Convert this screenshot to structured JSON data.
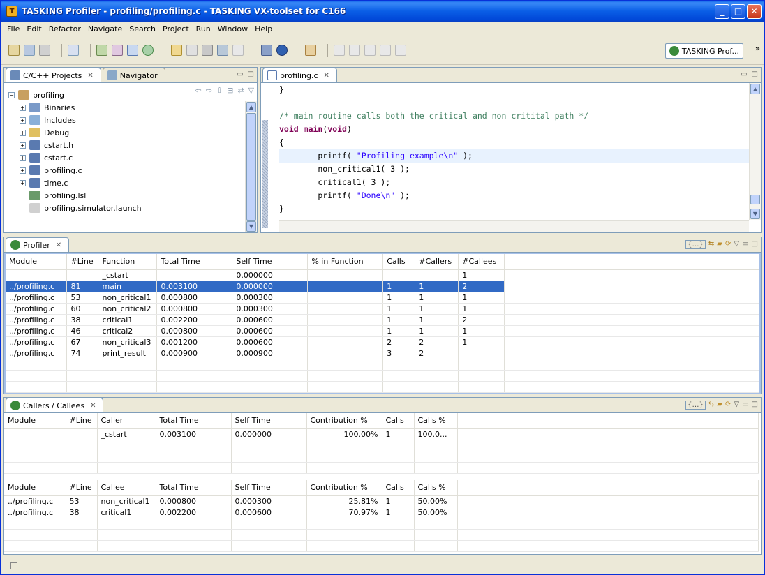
{
  "window": {
    "title": "TASKING Profiler - profiling/profiling.c - TASKING VX-toolset for C166",
    "minimize": "_",
    "maximize": "□",
    "close": "✕"
  },
  "menu": [
    "File",
    "Edit",
    "Refactor",
    "Navigate",
    "Search",
    "Project",
    "Run",
    "Window",
    "Help"
  ],
  "perspective": {
    "label": "TASKING Prof...",
    "more": "»"
  },
  "left_pane": {
    "tabs": [
      {
        "label": "C/C++ Projects"
      },
      {
        "label": "Navigator"
      }
    ],
    "close": "✕",
    "tree": [
      {
        "label": "profiling",
        "depth": 0,
        "toggle": "−"
      },
      {
        "label": "Binaries",
        "depth": 1,
        "toggle": "+"
      },
      {
        "label": "Includes",
        "depth": 1,
        "toggle": "+"
      },
      {
        "label": "Debug",
        "depth": 1,
        "toggle": "+"
      },
      {
        "label": "cstart.h",
        "depth": 1,
        "toggle": "+"
      },
      {
        "label": "cstart.c",
        "depth": 1,
        "toggle": "+"
      },
      {
        "label": "profiling.c",
        "depth": 1,
        "toggle": "+"
      },
      {
        "label": "time.c",
        "depth": 1,
        "toggle": "+"
      },
      {
        "label": "profiling.lsl",
        "depth": 1,
        "toggle": ""
      },
      {
        "label": "profiling.simulator.launch",
        "depth": 1,
        "toggle": ""
      }
    ]
  },
  "editor": {
    "tab": "profiling.c",
    "close": "✕",
    "lines": [
      {
        "parts": [
          {
            "t": "}",
            "c": ""
          }
        ]
      },
      {
        "parts": [
          {
            "t": "",
            "c": ""
          }
        ]
      },
      {
        "parts": [
          {
            "t": "/* main routine calls both the critical and non critital path */",
            "c": "cm"
          }
        ]
      },
      {
        "parts": [
          {
            "t": "void",
            "c": "kw"
          },
          {
            "t": " ",
            "c": ""
          },
          {
            "t": "main",
            "c": "kw"
          },
          {
            "t": "(",
            "c": ""
          },
          {
            "t": "void",
            "c": "kw"
          },
          {
            "t": ")",
            "c": ""
          }
        ]
      },
      {
        "parts": [
          {
            "t": "{",
            "c": ""
          }
        ]
      },
      {
        "parts": [
          {
            "t": "        printf( ",
            "c": ""
          },
          {
            "t": "\"Profiling example\\n\"",
            "c": "str"
          },
          {
            "t": " );",
            "c": ""
          }
        ],
        "highlight": true
      },
      {
        "parts": [
          {
            "t": "        non_critical1( 3 );",
            "c": ""
          }
        ]
      },
      {
        "parts": [
          {
            "t": "        critical1( 3 );",
            "c": ""
          }
        ]
      },
      {
        "parts": [
          {
            "t": "        printf( ",
            "c": ""
          },
          {
            "t": "\"Done\\n\"",
            "c": "str"
          },
          {
            "t": " );",
            "c": ""
          }
        ]
      },
      {
        "parts": [
          {
            "t": "}",
            "c": ""
          }
        ]
      }
    ]
  },
  "profiler": {
    "tab": "Profiler",
    "close": "✕",
    "columns": [
      "Module",
      "#Line",
      "Function",
      "Total Time",
      "Self Time",
      "% in Function",
      "Calls",
      "#Callers",
      "#Callees"
    ],
    "rows": [
      [
        "",
        "",
        "_cstart",
        "",
        "0.000000",
        "",
        "",
        "",
        "1"
      ],
      [
        "../profiling.c",
        "81",
        "main",
        "0.003100",
        "0.000000",
        "",
        "1",
        "1",
        "2"
      ],
      [
        "../profiling.c",
        "53",
        "non_critical1",
        "0.000800",
        "0.000300",
        "",
        "1",
        "1",
        "1"
      ],
      [
        "../profiling.c",
        "60",
        "non_critical2",
        "0.000800",
        "0.000300",
        "",
        "1",
        "1",
        "1"
      ],
      [
        "../profiling.c",
        "38",
        "critical1",
        "0.002200",
        "0.000600",
        "",
        "1",
        "1",
        "2"
      ],
      [
        "../profiling.c",
        "46",
        "critical2",
        "0.000800",
        "0.000600",
        "",
        "1",
        "1",
        "1"
      ],
      [
        "../profiling.c",
        "67",
        "non_critical3",
        "0.001200",
        "0.000600",
        "",
        "2",
        "2",
        "1"
      ],
      [
        "../profiling.c",
        "74",
        "print_result",
        "0.000900",
        "0.000900",
        "",
        "3",
        "2",
        ""
      ]
    ],
    "selected_row": 1
  },
  "callers": {
    "tab": "Callers / Callees",
    "close": "✕",
    "caller_columns": [
      "Module",
      "#Line",
      "Caller",
      "Total Time",
      "Self Time",
      "Contribution %",
      "Calls",
      "Calls %"
    ],
    "caller_rows": [
      [
        "",
        "",
        "_cstart",
        "0.003100",
        "0.000000",
        "100.00%",
        "1",
        "100.0..."
      ]
    ],
    "callee_columns": [
      "Module",
      "#Line",
      "Callee",
      "Total Time",
      "Self Time",
      "Contribution %",
      "Calls",
      "Calls %"
    ],
    "callee_rows": [
      [
        "../profiling.c",
        "53",
        "non_critical1",
        "0.000800",
        "0.000300",
        "25.81%",
        "1",
        "50.00%"
      ],
      [
        "../profiling.c",
        "38",
        "critical1",
        "0.002200",
        "0.000600",
        "70.97%",
        "1",
        "50.00%"
      ]
    ]
  },
  "colors": {
    "selection": "#316ac5",
    "keyword": "#7f0055",
    "comment": "#3f7f5f",
    "string": "#2a00ff"
  }
}
